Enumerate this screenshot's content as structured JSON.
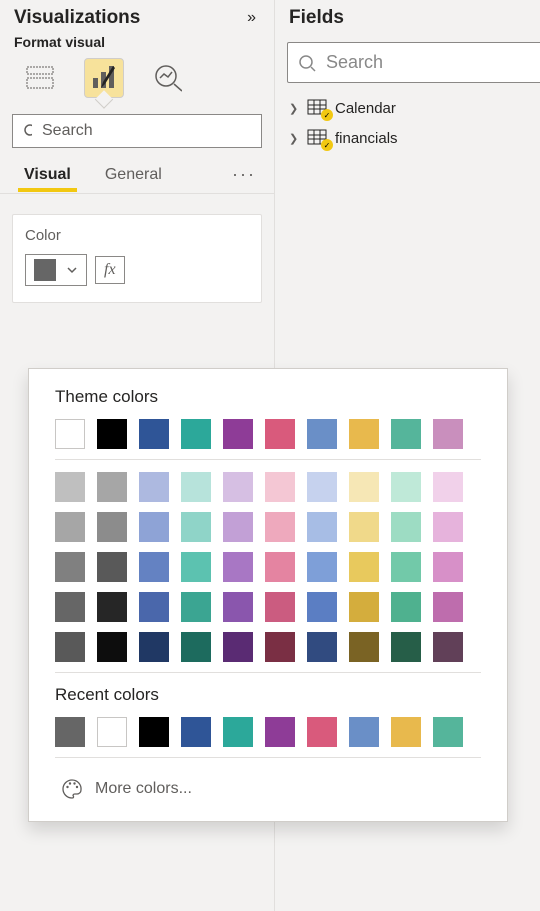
{
  "visualizations": {
    "title": "Visualizations",
    "subtitle": "Format visual",
    "search_placeholder": "Search",
    "tabs": {
      "visual": "Visual",
      "general": "General"
    },
    "color_section": {
      "label": "Color",
      "current": "#666666",
      "fx_label": "fx"
    }
  },
  "color_popup": {
    "theme_title": "Theme colors",
    "recent_title": "Recent colors",
    "more": "More colors...",
    "theme_row_main": [
      "#ffffff",
      "#000000",
      "#2f5597",
      "#2ca89a",
      "#8e3c97",
      "#d95a7c",
      "#6a8fc7",
      "#e8b94d",
      "#55b59b",
      "#c98fbd"
    ],
    "shade_rows": [
      [
        "#bfbfbf",
        "#a6a6a6",
        "#adb9e0",
        "#b7e3db",
        "#d6bfe3",
        "#f4c7d4",
        "#c6d2ee",
        "#f6e7b5",
        "#bfe9d8",
        "#f1d1ea"
      ],
      [
        "#a6a6a6",
        "#8c8c8c",
        "#8ea3d6",
        "#8fd4c8",
        "#c2a0d6",
        "#eea9bd",
        "#a7bde5",
        "#f0d98a",
        "#9ddcc3",
        "#e6b3dc"
      ],
      [
        "#808080",
        "#595959",
        "#6482c2",
        "#5cc2b0",
        "#a877c4",
        "#e484a1",
        "#7e9fd8",
        "#e8c95d",
        "#72c9a9",
        "#d790c8"
      ],
      [
        "#666666",
        "#262626",
        "#4a67ab",
        "#3ba592",
        "#8a56ad",
        "#cb5c80",
        "#5b7ec3",
        "#d4ad3d",
        "#4fb18f",
        "#be6dad"
      ],
      [
        "#595959",
        "#0d0d0d",
        "#203864",
        "#1d6b5e",
        "#5a2b73",
        "#7a2f44",
        "#314b80",
        "#7a6324",
        "#265e48",
        "#614058"
      ]
    ],
    "recent": [
      "#666666",
      "#ffffff",
      "#000000",
      "#2f5597",
      "#2ca89a",
      "#8e3c97",
      "#d95a7c",
      "#6a8fc7",
      "#e8b94d",
      "#55b59b"
    ]
  },
  "fields": {
    "title": "Fields",
    "search_placeholder": "Search",
    "tables": [
      {
        "name": "Calendar"
      },
      {
        "name": "financials"
      }
    ]
  }
}
